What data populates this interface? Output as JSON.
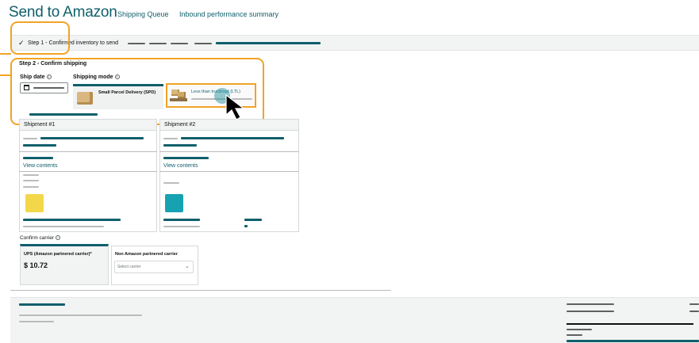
{
  "header": {
    "title": "Send to Amazon",
    "links": [
      "Shipping Queue",
      "Inbound performance summary"
    ]
  },
  "step1": {
    "check": "✓",
    "label": "Step 1 - Confirmed inventory to send"
  },
  "step2": {
    "label": "Step 2 - Confirm shipping",
    "ship_date_label": "Ship date",
    "shipping_mode_label": "Shipping mode",
    "info_glyph": "i",
    "modes": [
      {
        "label": "Small Parcel Delivery (SPD)",
        "icon": "box-icon"
      },
      {
        "label": "Less than truckload (LTL)",
        "icon": "pallet-icon"
      }
    ]
  },
  "shipments": [
    {
      "name": "Shipment #1",
      "view_contents": "View contents",
      "swatch_color": "#f3d74a"
    },
    {
      "name": "Shipment #2",
      "view_contents": "View contents",
      "swatch_color": "#17a2b2"
    }
  ],
  "carrier": {
    "label": "Confirm carrier",
    "options": [
      {
        "name": "UPS (Amazon partnered carrier)*",
        "price": "$ 10.72"
      },
      {
        "name": "Non Amazon partnered carrier",
        "select_placeholder": "Select carrier"
      }
    ],
    "chevron": "⌄"
  },
  "colors": {
    "accent": "#0f5f6b",
    "callout": "#f0a326"
  }
}
